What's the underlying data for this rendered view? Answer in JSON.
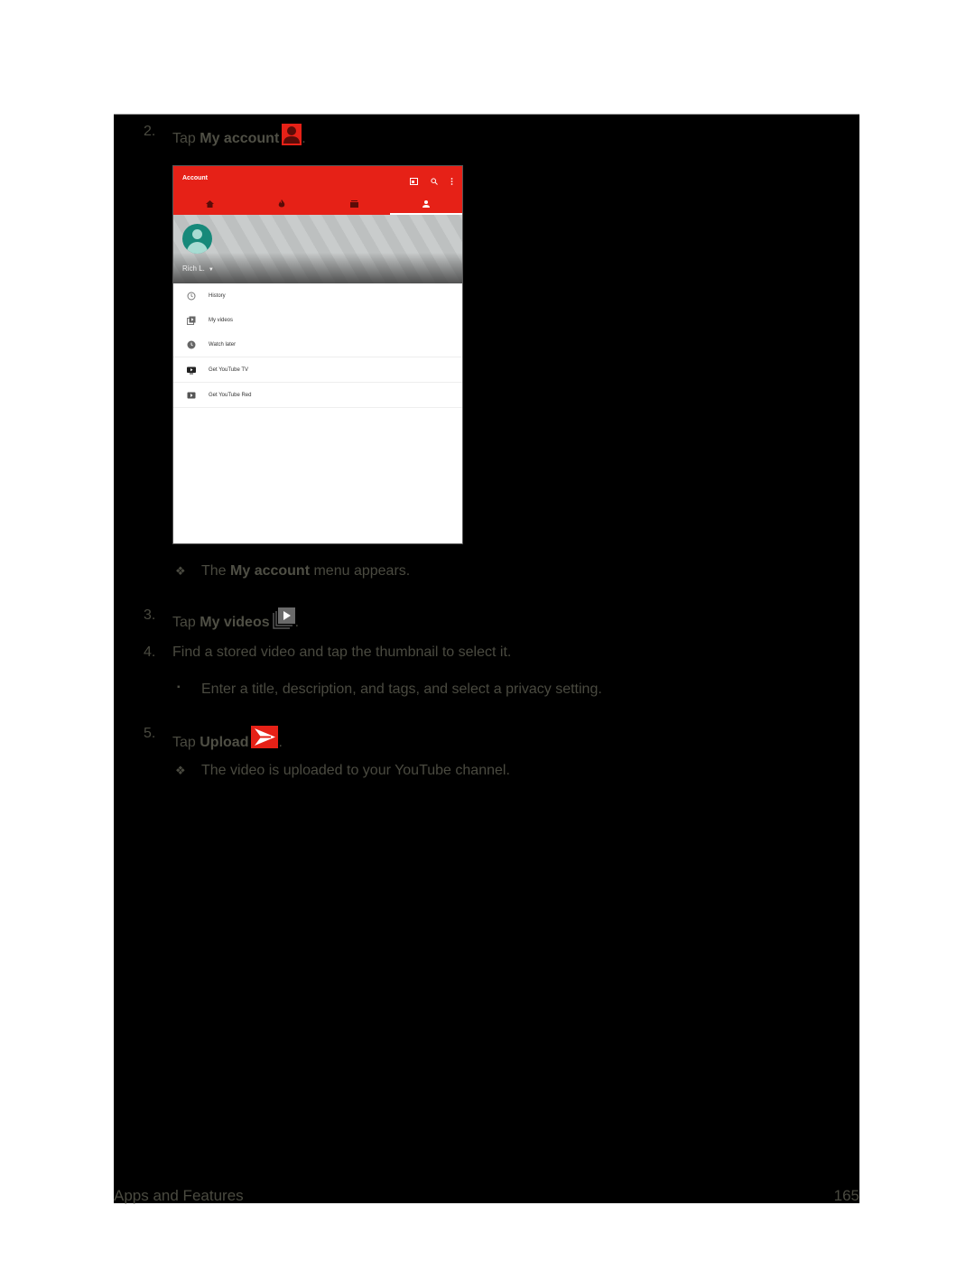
{
  "steps": [
    {
      "number": "2.",
      "prefix": "Tap ",
      "bold": "My account",
      "suffix": ".",
      "icon": "account-icon"
    },
    {
      "number": "3.",
      "prefix": "Tap ",
      "bold": "My videos",
      "suffix": ".",
      "icon": "my-videos-icon"
    },
    {
      "number": "4.",
      "text": "Find a stored video and tap the thumbnail to select it."
    },
    {
      "number": "5.",
      "prefix": "Tap ",
      "bold": "Upload",
      "suffix": ".",
      "icon": "upload-send-icon"
    }
  ],
  "results": {
    "account_menu": {
      "prefix": "The ",
      "bold": "My account",
      "suffix": " menu appears."
    },
    "uploaded": "The video is uploaded to your YouTube channel."
  },
  "sub_bullet": "Enter a title, description, and tags, and select a privacy setting.",
  "screenshot": {
    "title": "Account",
    "tabs": [
      "home-icon",
      "trending-icon",
      "subscriptions-icon",
      "account-icon"
    ],
    "active_tab": 3,
    "user_name": "Rich L.",
    "menu_items": [
      {
        "label": "History",
        "icon": "history-icon"
      },
      {
        "label": "My videos",
        "icon": "my-videos-icon"
      },
      {
        "label": "Watch later",
        "icon": "clock-icon"
      },
      {
        "label": "Get YouTube TV",
        "icon": "youtube-tv-icon"
      },
      {
        "label": "Get YouTube Red",
        "icon": "youtube-red-icon"
      }
    ],
    "accent_color": "#e62117"
  },
  "footer": {
    "section": "Apps and Features",
    "page_number": "165"
  }
}
